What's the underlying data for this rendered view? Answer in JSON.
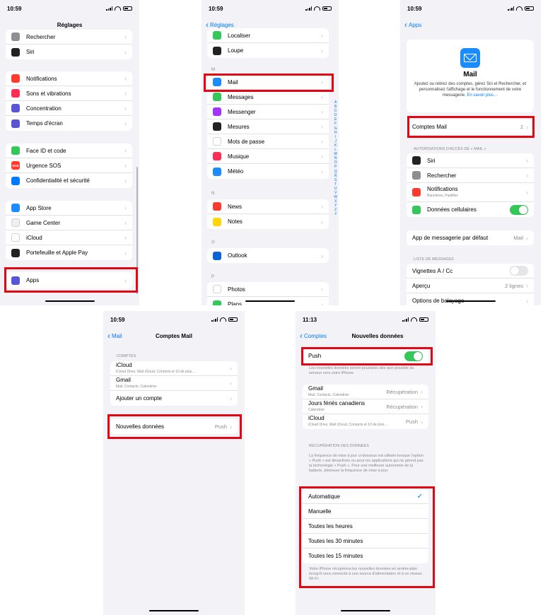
{
  "status": {
    "p1": "10:59",
    "p2": "10:59",
    "p3": "10:59",
    "p4": "10:59",
    "p5": "11:13"
  },
  "screen1": {
    "title": "Réglages",
    "group1": [
      {
        "label": "Rechercher",
        "icon": "search-icon",
        "color": "#8e8e93"
      },
      {
        "label": "Siri",
        "icon": "siri-icon",
        "color": "#222222"
      }
    ],
    "group2": [
      {
        "label": "Notifications",
        "icon": "bell-icon",
        "color": "#ff3b30"
      },
      {
        "label": "Sons et vibrations",
        "icon": "speaker-icon",
        "color": "#ff2d55"
      },
      {
        "label": "Concentration",
        "icon": "moon-icon",
        "color": "#5856d6"
      },
      {
        "label": "Temps d'écran",
        "icon": "hourglass-icon",
        "color": "#5856d6"
      }
    ],
    "group3": [
      {
        "label": "Face ID et code",
        "icon": "faceid-icon",
        "color": "#34c759"
      },
      {
        "label": "Urgence SOS",
        "icon": "sos-icon",
        "color": "#ff3b30",
        "glyph": "SOS"
      },
      {
        "label": "Confidentialité et sécurité",
        "icon": "hand-icon",
        "color": "#007aff"
      }
    ],
    "group4": [
      {
        "label": "App Store",
        "icon": "appstore-icon",
        "color": "#1a8cff"
      },
      {
        "label": "Game Center",
        "icon": "gamecenter-icon",
        "color": "#f0f0f0"
      },
      {
        "label": "iCloud",
        "icon": "icloud-icon",
        "color": "#ffffff"
      },
      {
        "label": "Portefeuille et Apple Pay",
        "icon": "wallet-icon",
        "color": "#222222"
      }
    ],
    "group5": [
      {
        "label": "Apps",
        "icon": "apps-grid-icon",
        "color": "#5856d6"
      }
    ]
  },
  "screen2": {
    "back": "Réglages",
    "top_rows": [
      {
        "label": "Localiser",
        "icon": "locate-icon",
        "color": "#34c759"
      },
      {
        "label": "Loupe",
        "icon": "magnifier-icon",
        "color": "#222222"
      }
    ],
    "letter_m": "M",
    "m_rows": [
      {
        "label": "Mail",
        "icon": "mail-icon",
        "color": "#1a8cff"
      },
      {
        "label": "Messages",
        "icon": "messages-icon",
        "color": "#34c759"
      },
      {
        "label": "Messenger",
        "icon": "messenger-icon",
        "color": "#a334fa"
      },
      {
        "label": "Mesures",
        "icon": "measure-icon",
        "color": "#222222"
      },
      {
        "label": "Mots de passe",
        "icon": "key-icon",
        "color": "#ffffff"
      },
      {
        "label": "Musique",
        "icon": "music-icon",
        "color": "#ff2d55"
      },
      {
        "label": "Météo",
        "icon": "weather-icon",
        "color": "#1a8cff"
      }
    ],
    "letter_n": "N",
    "n_rows": [
      {
        "label": "News",
        "icon": "news-icon",
        "color": "#ff3b30"
      },
      {
        "label": "Notes",
        "icon": "notes-icon",
        "color": "#ffd60a"
      }
    ],
    "letter_o": "O",
    "o_rows": [
      {
        "label": "Outlook",
        "icon": "outlook-icon",
        "color": "#0a64d6"
      }
    ],
    "letter_p": "P",
    "p_rows": [
      {
        "label": "Photos",
        "icon": "photos-icon",
        "color": "#ffffff"
      },
      {
        "label": "Plans",
        "icon": "maps-icon",
        "color": "#34c759"
      }
    ],
    "index": [
      "A",
      "B",
      "C",
      "D",
      "E",
      "F",
      "G",
      "H",
      "I",
      "J",
      "K",
      "L",
      "M",
      "N",
      "O",
      "P",
      "Q",
      "R",
      "S",
      "T",
      "U",
      "V",
      "W",
      "X",
      "Y",
      "Z",
      "#"
    ]
  },
  "screen3": {
    "back": "Apps",
    "app_name": "Mail",
    "description": "Ajoutez ou retirez des comptes, gérez Siri et Rechercher, et personnalisez l'affichage et le fonctionnement de votre messagerie.",
    "learn_more": "En savoir plus…",
    "accounts_label": "Comptes Mail",
    "accounts_value": "2",
    "access_header": "AUTORISATIONS D'ACCÈS DE « MAIL »",
    "access_rows": [
      {
        "label": "Siri",
        "icon": "siri-icon",
        "color": "#222222"
      },
      {
        "label": "Rechercher",
        "icon": "search-icon",
        "color": "#8e8e93"
      },
      {
        "label": "Notifications",
        "sub": "Bannières, Pastilles",
        "icon": "bell-icon",
        "color": "#ff3b30"
      },
      {
        "label": "Données cellulaires",
        "icon": "antenna-icon",
        "color": "#34c759"
      }
    ],
    "default_app_label": "App de messagerie par défaut",
    "default_app_value": "Mail",
    "list_header": "LISTE DE MESSAGES",
    "list_rows": [
      {
        "label": "Vignettes À / Cc"
      },
      {
        "label": "Aperçu",
        "value": "2 lignes"
      },
      {
        "label": "Options de balayage"
      }
    ]
  },
  "screen4": {
    "back": "Mail",
    "title": "Comptes Mail",
    "header": "COMPTES",
    "accounts": [
      {
        "label": "iCloud",
        "sub": "iCloud Drive, Mail iCloud, Contacts et 10 de plus…"
      },
      {
        "label": "Gmail",
        "sub": "Mail, Contacts, Calendrier"
      },
      {
        "label": "Ajouter un compte",
        "sub": ""
      }
    ],
    "fetch_label": "Nouvelles données",
    "fetch_value": "Push"
  },
  "screen5": {
    "back": "Comptes",
    "title": "Nouvelles données",
    "push_label": "Push",
    "push_note": "Les nouvelles données seront poussées dès que possible du serveur vers votre iPhone.",
    "accounts": [
      {
        "label": "Gmail",
        "sub": "Mail, Contacts, Calendrier",
        "value": "Récupération"
      },
      {
        "label": "Jours fériés canadiens",
        "sub": "Calendrier",
        "value": "Récupération"
      },
      {
        "label": "iCloud",
        "sub": "iCloud Drive, Mail iCloud, Contacts et 10 de plus…",
        "value": "Push"
      }
    ],
    "fetch_header": "RÉCUPÉRATION DES DONNÉES",
    "fetch_note": "La fréquence de mise à jour ci-dessous est utilisée lorsque l'option « Push » est désactivée ou pour les applications qui ne gèrent pas la technologie « Push ». Pour une meilleure autonomie de la batterie, diminuez la fréquence de mise à jour.",
    "options": [
      "Automatique",
      "Manuelle",
      "Toutes les heures",
      "Toutes les 30 minutes",
      "Toutes les 15 minutes"
    ],
    "bottom_note": "Votre iPhone récupérera les nouvelles données en arrière-plan lorsqu'il sera connecté à une source d'alimentation et à un réseau Wi-Fi."
  }
}
